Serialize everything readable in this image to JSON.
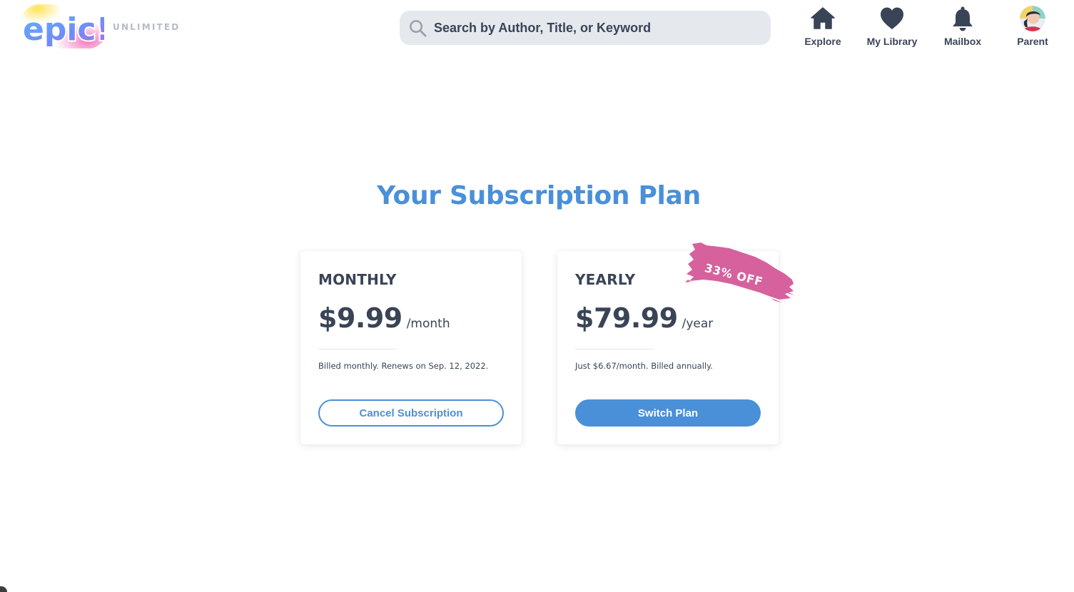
{
  "header": {
    "logo_text": "epic!",
    "tier": "UNLIMITED",
    "search": {
      "placeholder": "Search by Author, Title, or Keyword",
      "icon": "search-icon"
    },
    "nav": [
      {
        "label": "Explore",
        "icon": "home-icon"
      },
      {
        "label": "My Library",
        "icon": "heart-icon"
      },
      {
        "label": "Mailbox",
        "icon": "bell-icon"
      },
      {
        "label": "Parent",
        "icon": "avatar"
      }
    ]
  },
  "main": {
    "title": "Your Subscription Plan",
    "plans": [
      {
        "name": "MONTHLY",
        "price": "$9.99",
        "period": "/month",
        "note": "Billed monthly. Renews on Sep. 12, 2022.",
        "button": "Cancel Subscription"
      },
      {
        "name": "YEARLY",
        "price": "$79.99",
        "period": "/year",
        "note": "Just $6.67/month. Billed annually.",
        "button": "Switch Plan",
        "badge": "33% OFF"
      }
    ]
  },
  "colors": {
    "accent": "#4a90d9",
    "text": "#3a4457",
    "badge": "#d6619d",
    "search_bg": "#e5e8ed"
  }
}
